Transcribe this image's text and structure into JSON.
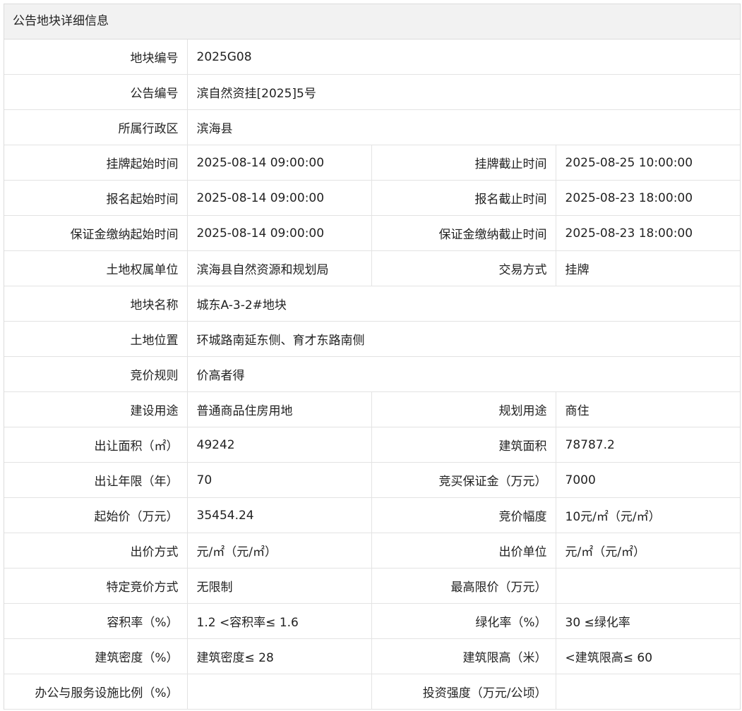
{
  "header": {
    "title": "公告地块详细信息"
  },
  "rows": [
    {
      "k1": "地块编号",
      "v1": "2025G08"
    },
    {
      "k1": "公告编号",
      "v1": "滨自然资挂[2025]5号"
    },
    {
      "k1": "所属行政区",
      "v1": "滨海县"
    },
    {
      "k1": "挂牌起始时间",
      "v1": "2025-08-14 09:00:00",
      "k2": "挂牌截止时间",
      "v2": "2025-08-25 10:00:00"
    },
    {
      "k1": "报名起始时间",
      "v1": "2025-08-14 09:00:00",
      "k2": "报名截止时间",
      "v2": "2025-08-23 18:00:00"
    },
    {
      "k1": "保证金缴纳起始时间",
      "v1": "2025-08-14 09:00:00",
      "k2": "保证金缴纳截止时间",
      "v2": "2025-08-23 18:00:00"
    },
    {
      "k1": "土地权属单位",
      "v1": "滨海县自然资源和规划局",
      "k2": "交易方式",
      "v2": "挂牌"
    },
    {
      "k1": "地块名称",
      "v1": "城东A-3-2#地块"
    },
    {
      "k1": "土地位置",
      "v1": "环城路南延东侧、育才东路南侧"
    },
    {
      "k1": "竞价规则",
      "v1": "价高者得"
    },
    {
      "k1": "建设用途",
      "v1": "普通商品住房用地",
      "k2": "规划用途",
      "v2": "商住"
    },
    {
      "k1": "出让面积（㎡）",
      "v1": "49242",
      "k2": "建筑面积",
      "v2": "78787.2"
    },
    {
      "k1": "出让年限（年）",
      "v1": "70",
      "k2": "竞买保证金（万元）",
      "v2": "7000"
    },
    {
      "k1": "起始价（万元）",
      "v1": "35454.24",
      "k2": "竞价幅度",
      "v2": "10元/㎡（元/㎡）"
    },
    {
      "k1": "出价方式",
      "v1": "元/㎡（元/㎡）",
      "k2": "出价单位",
      "v2": "元/㎡（元/㎡）"
    },
    {
      "k1": "特定竞价方式",
      "v1": "无限制",
      "k2": "最高限价（万元）",
      "v2": ""
    },
    {
      "k1": "容积率（%）",
      "v1": "1.2 <容积率≤ 1.6",
      "k2": "绿化率（%）",
      "v2": "30 ≤绿化率"
    },
    {
      "k1": "建筑密度（%）",
      "v1": "建筑密度≤ 28",
      "k2": "建筑限高（米）",
      "v2": "<建筑限高≤ 60"
    },
    {
      "k1": "办公与服务设施比例（%）",
      "v1": "",
      "k2": "投资强度（万元/公顷）",
      "v2": ""
    }
  ]
}
